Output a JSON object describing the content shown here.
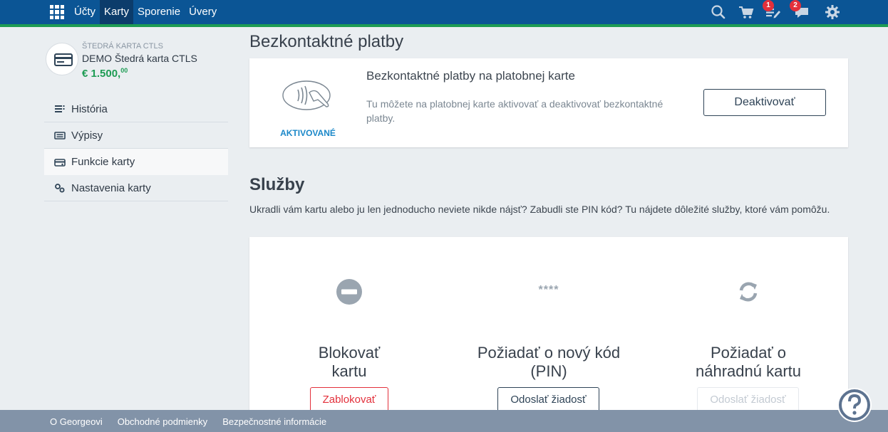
{
  "topnav": {
    "items": [
      "Účty",
      "Karty",
      "Sporenie",
      "Úvery"
    ],
    "active_index": 1,
    "badges": {
      "tasks": "1",
      "messages": "2"
    }
  },
  "account": {
    "type": "ŠTEDRÁ KARTA CTLS",
    "name": "DEMO Štedrá karta CTLS",
    "balance_main": "€ 1.500,",
    "balance_cents": "00"
  },
  "sidebar": {
    "items": [
      {
        "label": "História",
        "icon": "list-icon"
      },
      {
        "label": "Výpisy",
        "icon": "statement-icon"
      },
      {
        "label": "Funkcie karty",
        "icon": "card-icon"
      },
      {
        "label": "Nastavenia karty",
        "icon": "settings-icon"
      }
    ],
    "active_index": 2
  },
  "contactless": {
    "title": "Bezkontaktné platby",
    "status": "AKTIVOVANÉ",
    "heading": "Bezkontaktné platby na platobnej karte",
    "description": "Tu môžete na platobnej karte aktivovať a deaktivovať bezkontaktné platby.",
    "button": "Deaktivovať"
  },
  "services": {
    "title": "Služby",
    "description": "Ukradli vám kartu alebo ju len jednoducho neviete nikde nájsť? Zabudli ste PIN kód? Tu nájdete dôležité služby, ktoré vám pomôžu.",
    "items": [
      {
        "title_line1": "Blokovať",
        "title_line2": "kartu",
        "button": "Zablokovať",
        "icon": "block-icon"
      },
      {
        "title_line1": "Požiadať o nový kód",
        "title_line2": "(PIN)",
        "button": "Odoslať žiadosť",
        "icon": "pin-icon",
        "icon_text": "****"
      },
      {
        "title_line1": "Požiadať o",
        "title_line2": "náhradnú kartu",
        "button": "Odoslať žiadosť",
        "icon": "refresh-icon"
      }
    ]
  },
  "footer": {
    "links": [
      "O Georgeovi",
      "Obchodné podmienky",
      "Bezpečnostné informácie"
    ]
  },
  "colors": {
    "brand": "#0b5595",
    "accent_green": "#1e9c54",
    "danger": "#e3303b",
    "link_blue": "#1b88c9"
  }
}
